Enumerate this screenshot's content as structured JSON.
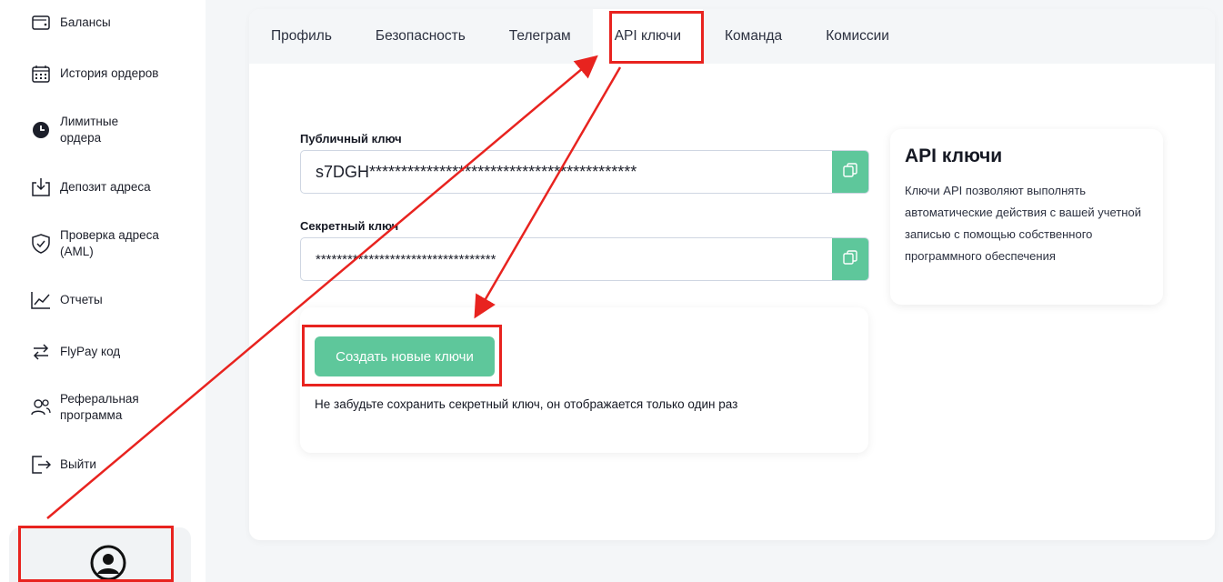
{
  "sidebar": {
    "items": [
      {
        "label": "Балансы",
        "icon": "wallet-icon"
      },
      {
        "label": "История ордеров",
        "icon": "calendar-icon"
      },
      {
        "label": "Лимитные ордера",
        "icon": "clock-icon"
      },
      {
        "label": "Депозит адреса",
        "icon": "download-tray-icon"
      },
      {
        "label": "Проверка адреса (AML)",
        "icon": "shield-check-icon"
      },
      {
        "label": "Отчеты",
        "icon": "chart-line-icon"
      },
      {
        "label": "FlyPay код",
        "icon": "swap-arrows-icon"
      },
      {
        "label": "Реферальная программа",
        "icon": "users-icon"
      },
      {
        "label": "Выйти",
        "icon": "logout-icon"
      }
    ],
    "profile_icon": "user-circle-icon"
  },
  "tabs": [
    "Профиль",
    "Безопасность",
    "Телеграм",
    "API ключи",
    "Команда",
    "Комиссии"
  ],
  "active_tab": "API ключи",
  "public_key": {
    "label": "Публичный ключ",
    "value": "s7DGH******************************************"
  },
  "secret_key": {
    "label": "Секретный ключ",
    "value": "**********************************"
  },
  "create": {
    "button_label": "Создать новые ключи",
    "note": "Не забудьте сохранить секретный ключ, он отображается только один раз"
  },
  "info": {
    "title": "API ключи",
    "text": "Ключи API позволяют выполнять автоматические действия с вашей учетной записью с помощью собственного программного обеспечения"
  },
  "colors": {
    "accent": "#5ec79b",
    "annotation": "#e8231f"
  }
}
